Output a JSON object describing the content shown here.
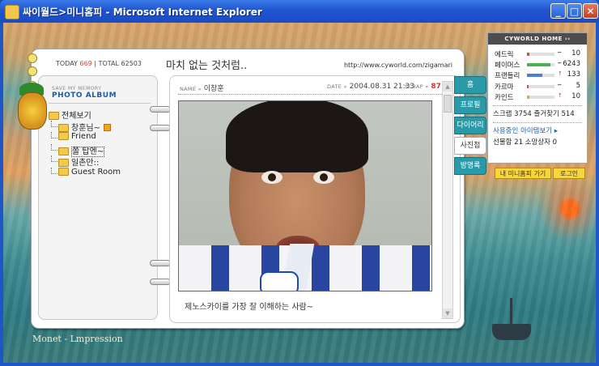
{
  "window": {
    "title": "싸이월드>미니홈피 - Microsoft Internet Explorer",
    "min": "_",
    "max": "□",
    "close": "✕"
  },
  "counter": {
    "today_label": "TODAY",
    "today": "669",
    "total_label": "TOTAL",
    "total": "62503"
  },
  "header": {
    "title": "마치 없는 것처럼..",
    "url": "http://www.cyworld.com/zigamari"
  },
  "album": {
    "sub": "SAVE MY MEMORY",
    "title": "PHOTO ALBUM",
    "folders": [
      {
        "label": "전체보기"
      },
      {
        "label": "창훈님~"
      },
      {
        "label": "Friend"
      },
      {
        "label": "쫄 탑엔~"
      },
      {
        "label": "일촌만::"
      },
      {
        "label": "Guest Room"
      }
    ]
  },
  "post": {
    "name_label": "NAME »",
    "name": "이창훈",
    "date_label": "DATE »",
    "date": "2004.08.31 21:33",
    "scrap_label": "SCRAP »",
    "scrap": "87",
    "caption": "제노스카이를 가장 잘 이해하는 사람~"
  },
  "tabs": [
    {
      "label": "홈"
    },
    {
      "label": "프로필"
    },
    {
      "label": "다이어리"
    },
    {
      "label": "사진첩"
    },
    {
      "label": "방명록"
    }
  ],
  "panel": {
    "title": "CYWORLD HOME ››",
    "stats": [
      {
        "label": "에드릭",
        "value": "10",
        "fill": 0.1,
        "color": "#d64a4a"
      },
      {
        "label": "페이머스",
        "value": "6243",
        "fill": 0.85,
        "color": "#4caf50"
      },
      {
        "label": "프랜들리",
        "value": "133",
        "fill": 0.55,
        "color": "#4a7fd6"
      },
      {
        "label": "카르마",
        "value": "5",
        "fill": 0.05,
        "color": "#d64a4a"
      },
      {
        "label": "카인드",
        "value": "10",
        "fill": 0.1,
        "color": "#d6b04a"
      }
    ],
    "scrap_line": "스크랩 3754 즐거찾기 514",
    "item_line": "사용중인 아이템보기 ▸",
    "gift_line": "선물함 21 소망상자 0",
    "btn_go": "내 미니홈피 가기",
    "btn_login": "로그인"
  },
  "footer": {
    "signature": "Monet - Lmpression"
  }
}
